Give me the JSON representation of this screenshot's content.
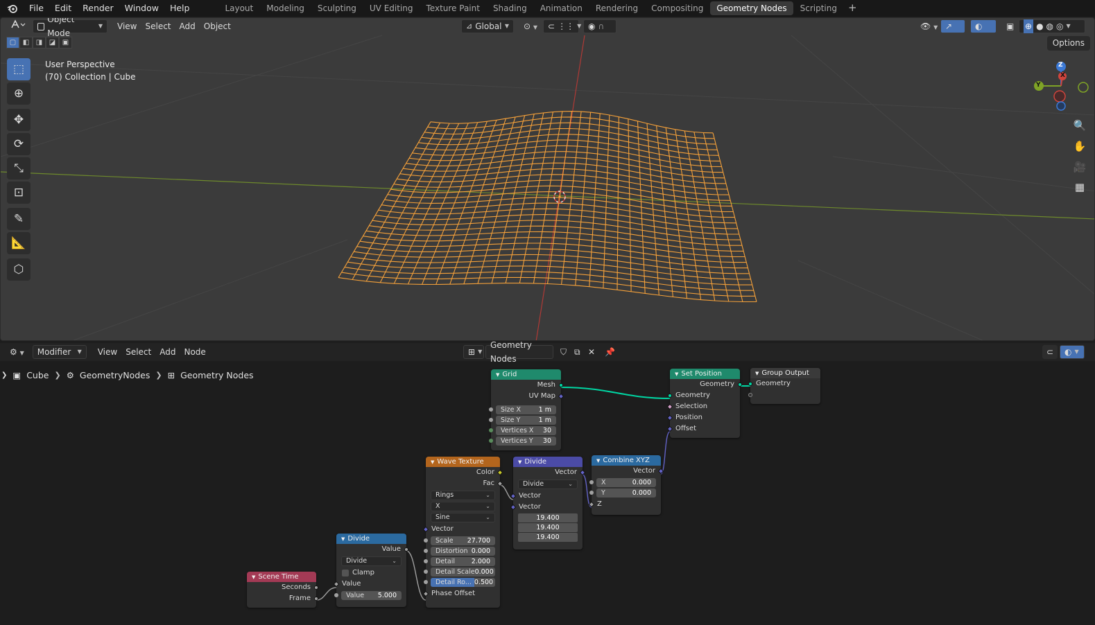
{
  "topbar": {
    "menus": [
      "File",
      "Edit",
      "Render",
      "Window",
      "Help"
    ],
    "workspaces": [
      "Layout",
      "Modeling",
      "Sculpting",
      "UV Editing",
      "Texture Paint",
      "Shading",
      "Animation",
      "Rendering",
      "Compositing",
      "Geometry Nodes",
      "Scripting"
    ],
    "active_workspace": "Geometry Nodes",
    "add_tab": "+"
  },
  "viewport": {
    "mode": "Object Mode",
    "menus": [
      "View",
      "Select",
      "Add",
      "Object"
    ],
    "transform_orientation": "Global",
    "options_label": "Options",
    "perspective_label": "User Perspective",
    "collection_label": "(70) Collection | Cube",
    "gizmo_axes": {
      "x": "X",
      "y": "Y",
      "z": "Z"
    },
    "colors": {
      "wire": "#f5a13a",
      "x_axis": "#d0443c",
      "y_axis": "#7fa326",
      "z_axis": "#3b79d6"
    }
  },
  "node_editor": {
    "context": "Modifier",
    "menus": [
      "View",
      "Select",
      "Add",
      "Node"
    ],
    "node_group": "Geometry Nodes",
    "breadcrumb": [
      "Cube",
      "GeometryNodes",
      "Geometry Nodes"
    ]
  },
  "nodes": {
    "grid": {
      "title": "Grid",
      "out_mesh": "Mesh",
      "out_uvmap": "UV Map",
      "size_x_label": "Size X",
      "size_x": "1 m",
      "size_y_label": "Size Y",
      "size_y": "1 m",
      "vert_x_label": "Vertices X",
      "vert_x": "30",
      "vert_y_label": "Vertices Y",
      "vert_y": "30"
    },
    "set_position": {
      "title": "Set Position",
      "out_geometry": "Geometry",
      "in_geometry": "Geometry",
      "in_selection": "Selection",
      "in_position": "Position",
      "in_offset": "Offset"
    },
    "group_output": {
      "title": "Group Output",
      "in_geometry": "Geometry"
    },
    "wave_texture": {
      "title": "Wave Texture",
      "out_color": "Color",
      "out_fac": "Fac",
      "wave_type": "Rings",
      "direction": "X",
      "profile": "Sine",
      "in_vector": "Vector",
      "scale_label": "Scale",
      "scale": "27.700",
      "distortion_label": "Distortion",
      "distortion": "0.000",
      "detail_label": "Detail",
      "detail": "2.000",
      "detail_scale_label": "Detail Scale",
      "detail_scale": "0.000",
      "detail_rough_label": "Detail Ro...",
      "detail_rough": "0.500",
      "phase_label": "Phase Offset"
    },
    "divide_vec": {
      "title": "Divide",
      "out_vector": "Vector",
      "operation": "Divide",
      "in_vector_a": "Vector",
      "in_vector_b": "Vector",
      "values": [
        "19.400",
        "19.400",
        "19.400"
      ]
    },
    "combine_xyz": {
      "title": "Combine XYZ",
      "out_vector": "Vector",
      "x_label": "X",
      "x": "0.000",
      "y_label": "Y",
      "y": "0.000",
      "z_label": "Z"
    },
    "divide_math": {
      "title": "Divide",
      "out_value": "Value",
      "operation": "Divide",
      "clamp_label": "Clamp",
      "in_value_label": "Value",
      "value_label": "Value",
      "value": "5.000"
    },
    "scene_time": {
      "title": "Scene Time",
      "out_seconds": "Seconds",
      "out_frame": "Frame"
    }
  }
}
